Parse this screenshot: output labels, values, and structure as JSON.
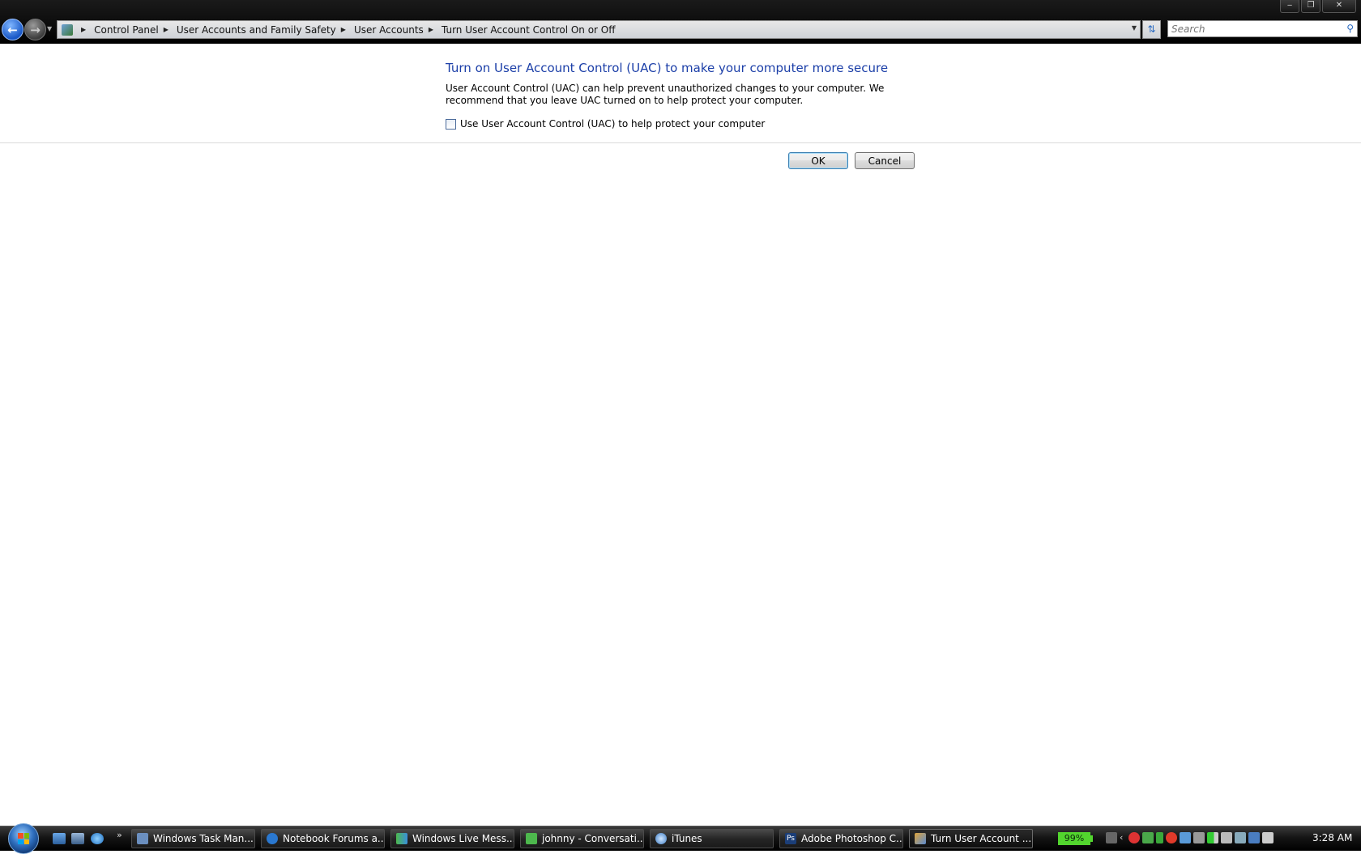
{
  "window": {
    "controls": {
      "minimize": "‒",
      "maximize": "❐",
      "close": "✕"
    }
  },
  "navigation": {
    "back_icon": "back-arrow-icon",
    "forward_icon": "forward-arrow-icon",
    "breadcrumbs": [
      "Control Panel",
      "User Accounts and Family Safety",
      "User Accounts",
      "Turn User Account Control On or Off"
    ],
    "search_placeholder": "Search"
  },
  "main": {
    "heading": "Turn on User Account Control (UAC) to make your computer more secure",
    "description": "User Account Control (UAC) can help prevent unauthorized changes to your computer.  We recommend that you leave UAC turned on to help protect your computer.",
    "checkbox_label": "Use User Account Control (UAC) to help protect your computer",
    "checkbox_checked": false,
    "ok_label": "OK",
    "cancel_label": "Cancel"
  },
  "taskbar": {
    "tasks": [
      {
        "label": "Windows Task Man...",
        "icon": "task-manager-icon",
        "active": false
      },
      {
        "label": "Notebook Forums a...",
        "icon": "ie-icon",
        "active": false
      },
      {
        "label": "Windows Live Mess...",
        "icon": "messenger-icon",
        "active": false
      },
      {
        "label": "johnny - Conversati...",
        "icon": "messenger-contact-icon",
        "active": false
      },
      {
        "label": "iTunes",
        "icon": "itunes-icon",
        "active": false
      },
      {
        "label": "Adobe Photoshop C...",
        "icon": "photoshop-icon",
        "active": false
      },
      {
        "label": "Turn User Account ...",
        "icon": "control-panel-icon",
        "active": true
      }
    ],
    "battery": "99%",
    "clock": "3:28 AM",
    "photoshop_icon_text": "Ps"
  },
  "colors": {
    "heading": "#1c3fa8",
    "battery": "#52d52e"
  }
}
